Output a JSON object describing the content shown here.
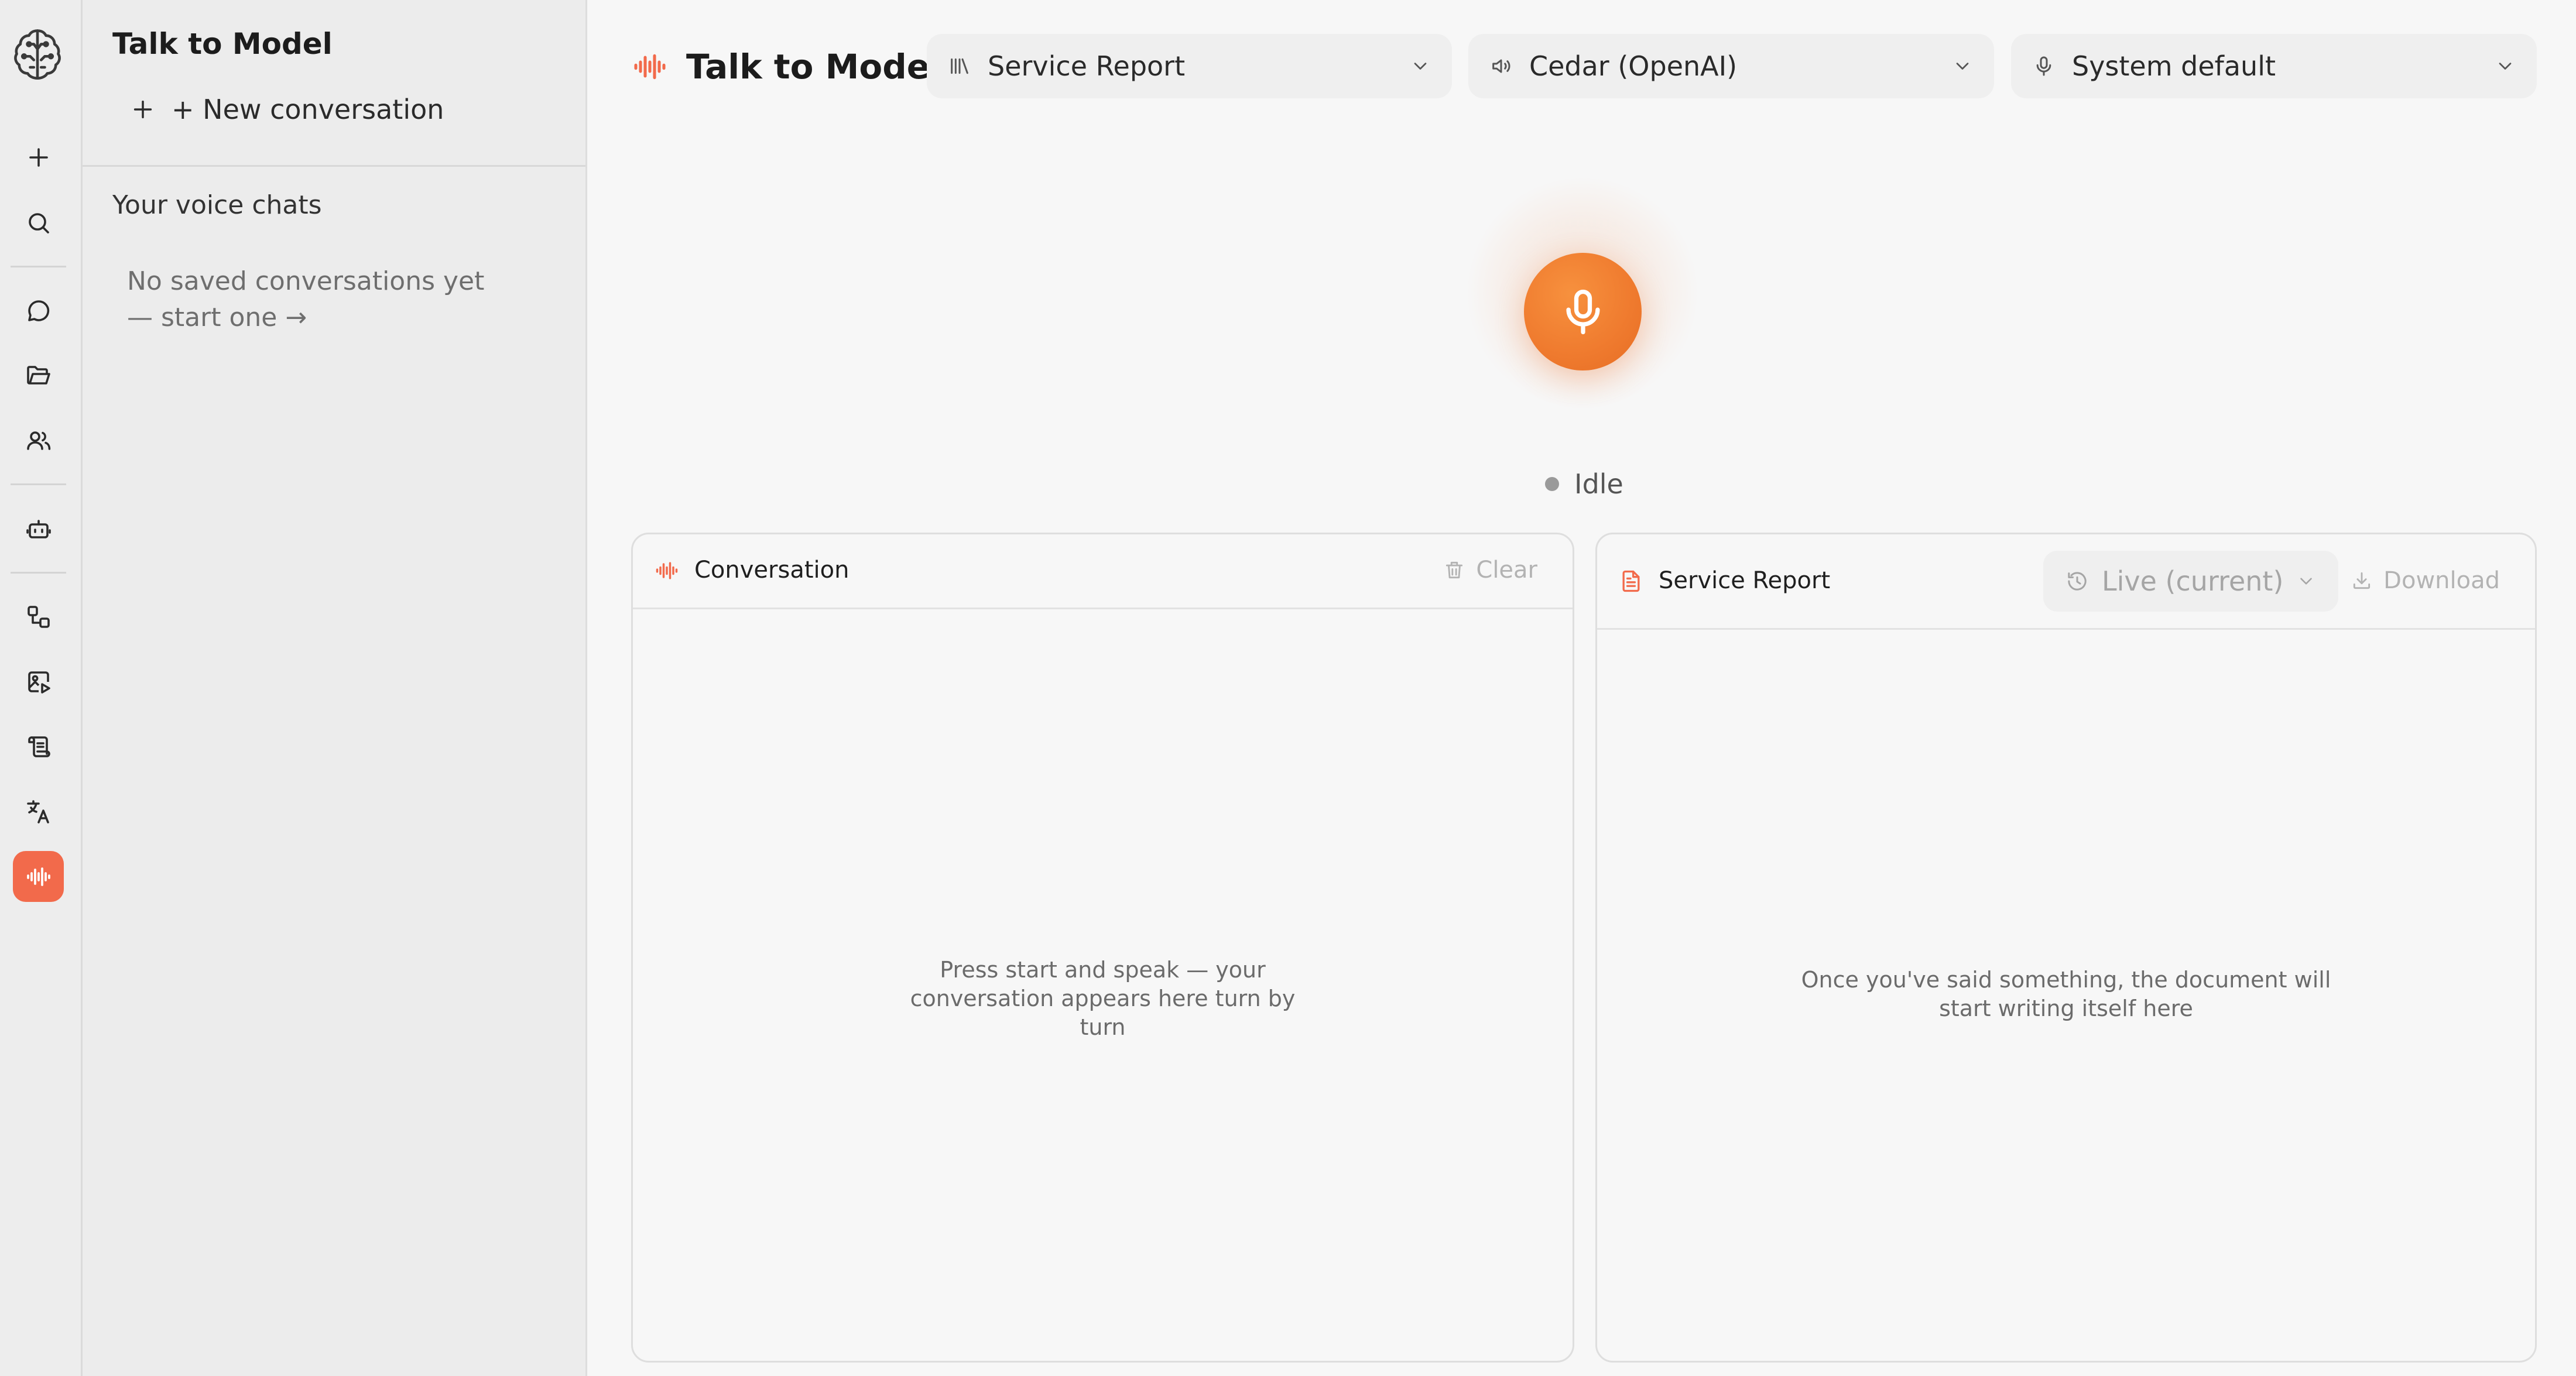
{
  "sidebar": {
    "title": "Talk to Model",
    "new_conversation_label": "+ New conversation",
    "section_title": "Your voice chats",
    "empty_text": "No saved conversations yet — start one →"
  },
  "rail": {
    "items": [
      "logo-icon",
      "plus-icon",
      "search-icon",
      "chat-icon",
      "folder-icon",
      "users-icon",
      "bot-icon",
      "workflow-icon",
      "image-icon",
      "scroll-icon",
      "translate-icon",
      "voice-wave-icon"
    ],
    "active": "voice-wave-icon",
    "accent": "#f26a4b"
  },
  "header": {
    "title": "Talk to Model",
    "document_select": {
      "value": "Service Report"
    },
    "voice_select": {
      "value": "Cedar (OpenAI)"
    },
    "mic_select": {
      "value": "System default"
    }
  },
  "mic": {
    "status": "Idle",
    "orb_color": "#ef7a2e"
  },
  "conversation_panel": {
    "title": "Conversation",
    "clear_label": "Clear",
    "empty_text": "Press start and speak — your conversation appears here turn by turn"
  },
  "document_panel": {
    "title": "Service Report",
    "version_value": "Live (current)",
    "download_label": "Download",
    "empty_text": "Once you've said something, the document will start writing itself here"
  }
}
